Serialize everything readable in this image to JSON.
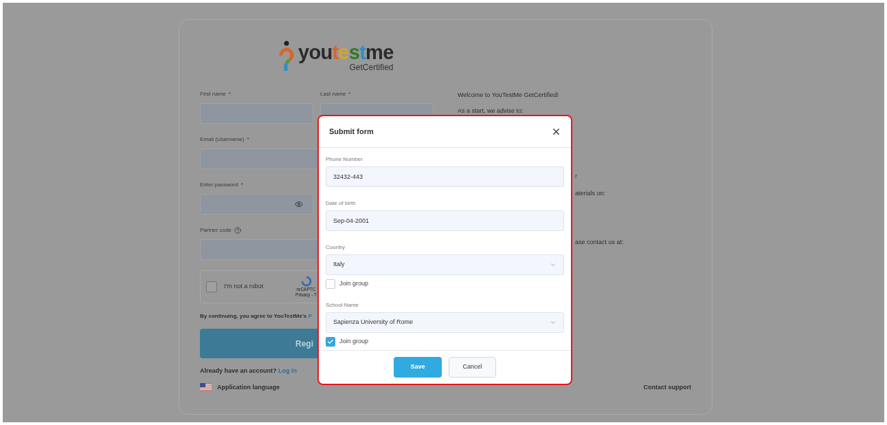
{
  "logo": {
    "parts": [
      {
        "text": "you",
        "color": "#2b2b2b"
      },
      {
        "text": "t",
        "color": "#d9652b"
      },
      {
        "text": "e",
        "color": "#d6a62a"
      },
      {
        "text": "s",
        "color": "#2f7a2a"
      },
      {
        "text": "t",
        "color": "#2a8fc9"
      },
      {
        "text": "me",
        "color": "#2b2b2b"
      }
    ],
    "tagline": "GetCertified"
  },
  "form": {
    "fields": [
      {
        "label": "First name",
        "mark": "*",
        "kind": "text"
      },
      {
        "label": "Last name",
        "mark": "*",
        "kind": "text"
      },
      {
        "label": "Email (Username)",
        "mark": "*",
        "kind": "text"
      },
      {
        "label": "Enter password",
        "mark": "*",
        "kind": "password"
      },
      {
        "label": "Partner code",
        "kind": "help"
      }
    ],
    "captcha": {
      "label": "I'm not a robot",
      "checked": false,
      "brand": "reCAPTC",
      "links": "Privacy - T"
    },
    "consent": {
      "text": "By continuing, you agree to YouTestMe's ",
      "link": "P"
    },
    "register_button": "Regi",
    "login_prompt": {
      "text": "Already have an account?",
      "link": "Log in"
    }
  },
  "info": {
    "lines": [
      {
        "text": "Welcome to YouTestMe GetCertified!",
        "kind": "full"
      },
      {
        "text": "As a start, we advise to:",
        "kind": "full"
      },
      {
        "text": "r",
        "kind": "link"
      },
      {
        "text": "aterials on:",
        "kind": "fragment"
      },
      {
        "text": "ase contact us at:",
        "kind": "fragment"
      }
    ]
  },
  "footer": {
    "language": "Application language",
    "contact": "Contact support"
  },
  "modal": {
    "title": "Submit form",
    "fields": [
      {
        "label": "Phone Number",
        "value": "32432-443",
        "kind": "input"
      },
      {
        "label": "Date of birth",
        "value": "Sep-04-2001",
        "kind": "input"
      },
      {
        "label": "Country",
        "value": "Italy",
        "kind": "select",
        "join": {
          "label": "Join group",
          "checked": false
        }
      },
      {
        "label": "School Name",
        "value": "Sapienza University of Rome",
        "kind": "select",
        "join": {
          "label": "Join group",
          "checked": true
        }
      }
    ],
    "buttons": [
      {
        "label": "Save",
        "kind": "primary"
      },
      {
        "label": "Cancel",
        "kind": "secondary"
      }
    ]
  }
}
